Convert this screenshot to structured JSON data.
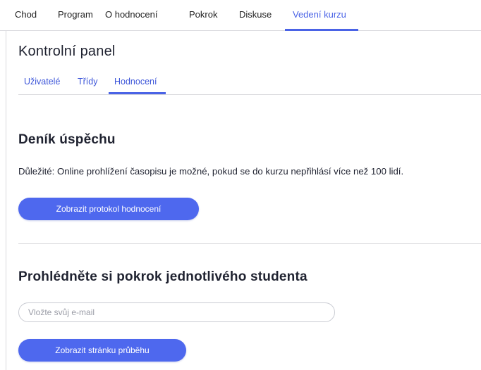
{
  "topnav": {
    "tabs": [
      {
        "label": "Chod"
      },
      {
        "label": "Program"
      },
      {
        "label": "O hodnocení"
      },
      {
        "label": "Pokrok"
      },
      {
        "label": "Diskuse"
      },
      {
        "label": "Vedení kurzu",
        "active": true
      }
    ]
  },
  "dashboard": {
    "title": "Kontrolní panel",
    "tabs": [
      {
        "label": "Uživatelé"
      },
      {
        "label": "Třídy"
      },
      {
        "label": "Hodnocení",
        "active": true
      }
    ]
  },
  "success_log": {
    "title": "Deník úspěchu",
    "notice": "Důležité: Online prohlížení časopisu je možné, pokud se do kurzu nepřihlásí více než 100 lidí.",
    "button_label": "Zobrazit protokol hodnocení"
  },
  "student_progress": {
    "title": "Prohlédněte si pokrok jednotlivého studenta",
    "email_placeholder": "Vložte svůj e-mail",
    "email_value": "",
    "button_label": "Zobrazit stránku průběhu"
  },
  "colors": {
    "accent": "#4a63e6",
    "button": "#4e68ee",
    "divider": "#d9d9dd"
  }
}
